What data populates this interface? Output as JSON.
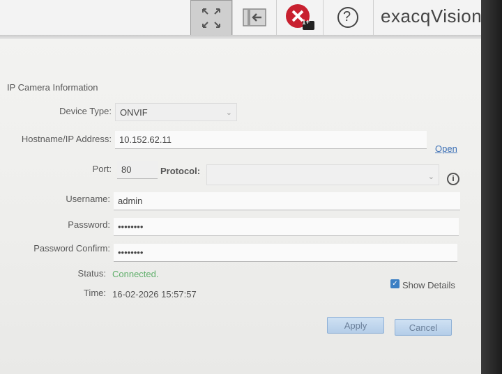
{
  "brand": {
    "name": "exacqVision"
  },
  "toolbar": {
    "error_badge": "1+",
    "help_glyph": "?",
    "icons": [
      "expand-arrows-icon",
      "exit-panel-icon",
      "error-x-icon",
      "help-icon"
    ]
  },
  "form": {
    "section_title": "IP Camera Information",
    "device_type": {
      "label": "Device Type:",
      "value": "ONVIF"
    },
    "hostname": {
      "label": "Hostname/IP Address:",
      "value": "10.152.62.11",
      "open_link": "Open"
    },
    "port": {
      "label": "Port:",
      "value": "80"
    },
    "protocol": {
      "label": "Protocol:",
      "value": ""
    },
    "username": {
      "label": "Username:",
      "value": "admin"
    },
    "password": {
      "label": "Password:",
      "value": "••••••••"
    },
    "password_confirm": {
      "label": "Password Confirm:",
      "value": "••••••••"
    },
    "status": {
      "label": "Status:",
      "value": "Connected."
    },
    "time": {
      "label": "Time:",
      "value": "16-02-2026 15:57:57"
    },
    "show_details": {
      "label": "Show Details",
      "checked": true
    }
  },
  "buttons": {
    "apply": "Apply",
    "cancel": "Cancel"
  },
  "colors": {
    "status_ok": "#5fae6a",
    "link": "#3b6fb5",
    "error_red": "#c8202f",
    "checkbox": "#3b7fc4"
  }
}
